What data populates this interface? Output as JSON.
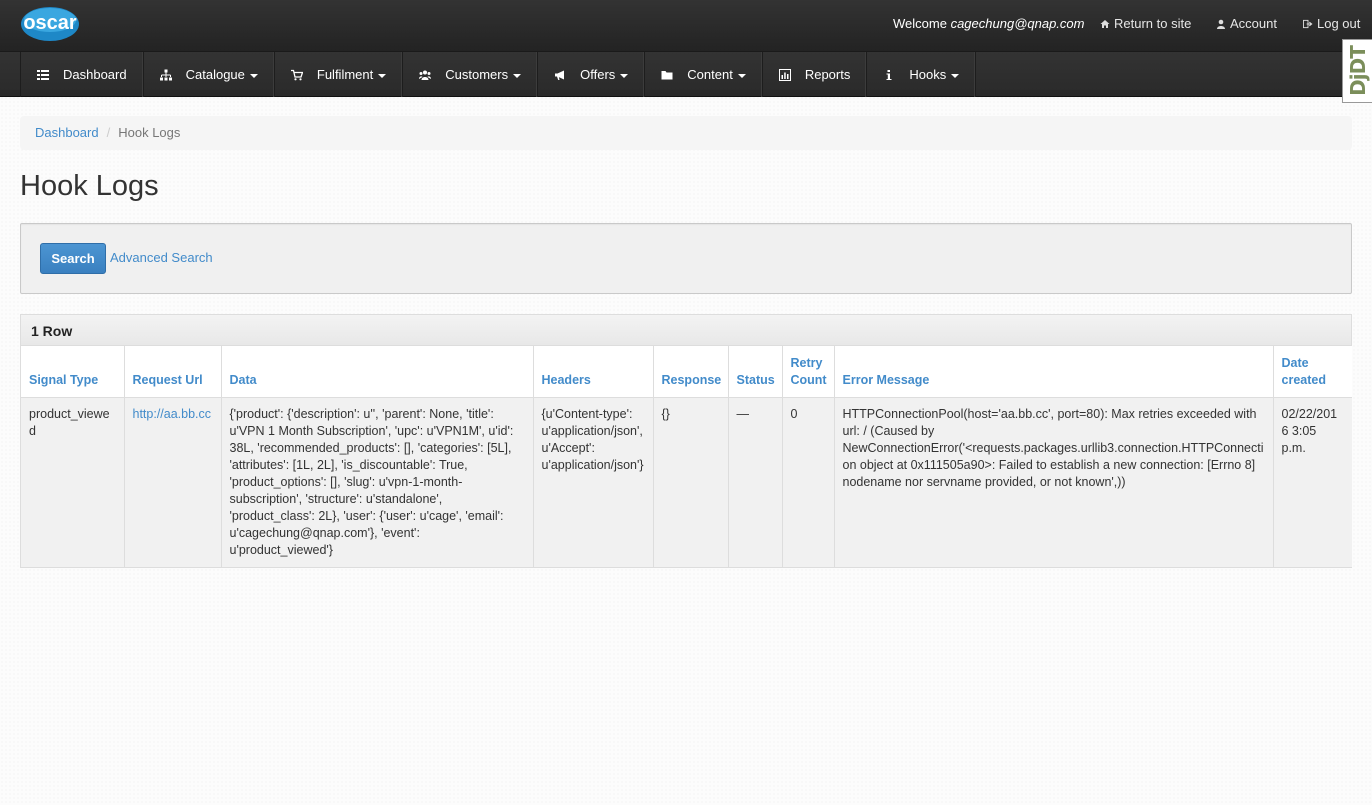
{
  "header": {
    "logo_text": "oscar",
    "welcome_prefix": "Welcome",
    "welcome_user": "cagechung@qnap.com",
    "links": {
      "return_to_site": "Return to site",
      "account": "Account",
      "logout": "Log out"
    }
  },
  "nav": {
    "items": [
      {
        "label": "Dashboard",
        "icon": "list-icon",
        "dropdown": false
      },
      {
        "label": "Catalogue",
        "icon": "sitemap-icon",
        "dropdown": true
      },
      {
        "label": "Fulfilment",
        "icon": "cart-icon",
        "dropdown": true
      },
      {
        "label": "Customers",
        "icon": "group-icon",
        "dropdown": true
      },
      {
        "label": "Offers",
        "icon": "bullhorn-icon",
        "dropdown": true
      },
      {
        "label": "Content",
        "icon": "folder-icon",
        "dropdown": true
      },
      {
        "label": "Reports",
        "icon": "bar-chart-icon",
        "dropdown": false
      },
      {
        "label": "Hooks",
        "icon": "info-icon",
        "dropdown": true
      }
    ]
  },
  "djdt_label": "DjDT",
  "breadcrumb": {
    "home": "Dashboard",
    "separator": "/",
    "current": "Hook Logs"
  },
  "page_title": "Hook Logs",
  "search": {
    "button_label": "Search",
    "advanced_label": "Advanced Search"
  },
  "table": {
    "caption": "1 Row",
    "columns": [
      "Signal Type",
      "Request Url",
      "Data",
      "Headers",
      "Response",
      "Status",
      "Retry Count",
      "Error Message",
      "Date created"
    ],
    "rows": [
      {
        "signal_type": "product_viewed",
        "request_url": "http://aa.bb.cc",
        "data": "{'product': {'description': u'', 'parent': None, 'title': u'VPN 1 Month Subscription', 'upc': u'VPN1M', u'id': 38L, 'recommended_products': [], 'categories': [5L], 'attributes': [1L, 2L], 'is_discountable': True, 'product_options': [], 'slug': u'vpn-1-month-subscription', 'structure': u'standalone', 'product_class': 2L}, 'user': {'user': u'cage', 'email': u'cagechung@qnap.com'}, 'event': u'product_viewed'}",
        "headers": "{u'Content-type': u'application/json', u'Accept': u'application/json'}",
        "response": "{}",
        "status": "—",
        "retry_count": "0",
        "error_message": "HTTPConnectionPool(host='aa.bb.cc', port=80): Max retries exceeded with url: / (Caused by NewConnectionError('<requests.packages.urllib3.connection.HTTPConnection object at 0x111505a90>: Failed to establish a new connection: [Errno 8] nodename nor servname provided, or not known',))",
        "date_created": "02/22/2016 3:05 p.m."
      }
    ]
  },
  "colors": {
    "link": "#428bca",
    "nav_bg": "#2f2f2f",
    "button_primary": "#428bca"
  }
}
